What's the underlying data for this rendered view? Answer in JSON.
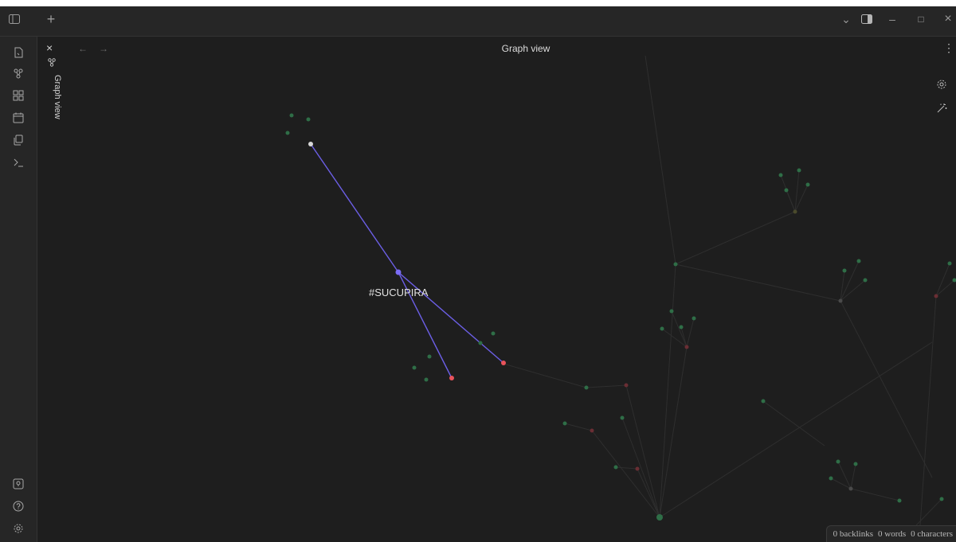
{
  "window": {
    "new_tab": "+",
    "min": "–",
    "max": "□",
    "close": "×",
    "chevron": "⌄"
  },
  "tab": {
    "close": "×",
    "label": "Graph view"
  },
  "view": {
    "title": "Graph view",
    "back": "←",
    "forward": "→",
    "more": "⋮"
  },
  "graph": {
    "focused_label": "#SUCUPIRA",
    "colors": {
      "accent": "#7b6cf5",
      "node_green": "#2f6e47",
      "node_red": "#e8535b",
      "node_white": "#d8d8d8",
      "edge": "#3a3a3a"
    }
  },
  "status": {
    "backlinks": "0 backlinks",
    "words": "0 words",
    "characters": "0 characters"
  },
  "icons": {
    "sidebar_toggle": "sidebar-toggle-icon",
    "files": "files-icon",
    "graph": "graph-icon",
    "canvas": "canvas-icon",
    "calendar": "calendar-icon",
    "copy": "copy-icon",
    "terminal": "terminal-icon",
    "vault": "vault-icon",
    "help": "help-icon",
    "settings": "gear-icon",
    "magic": "magic-wand-icon"
  }
}
